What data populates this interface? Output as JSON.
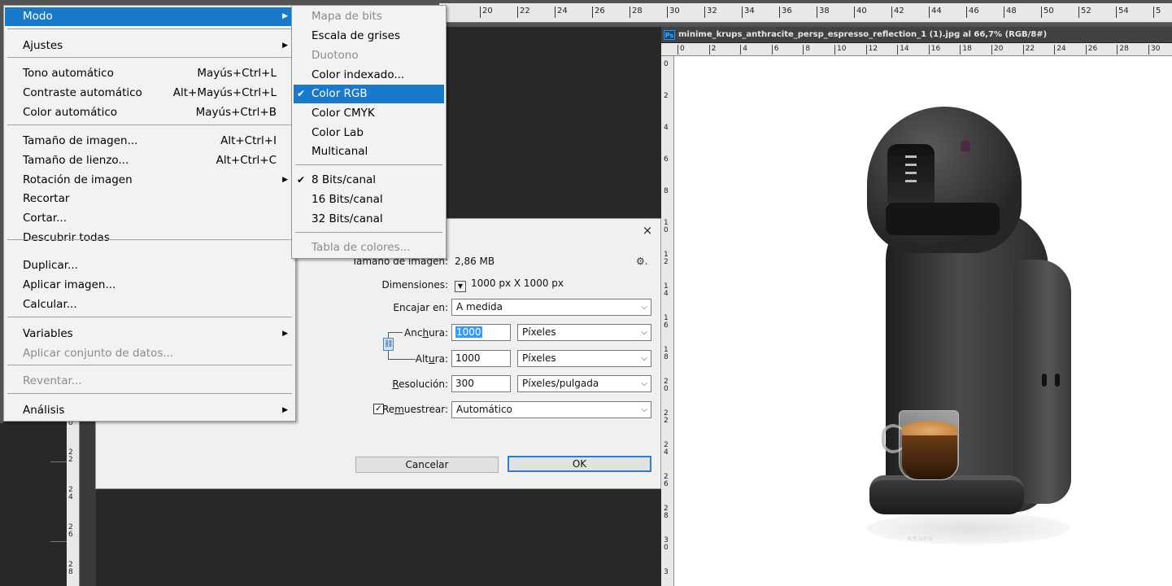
{
  "menu": {
    "items": [
      {
        "label": "Modo",
        "shortcut": "",
        "submenu": true,
        "highlighted": true,
        "disabled": false
      },
      {
        "label": "Ajustes",
        "shortcut": "",
        "submenu": true,
        "highlighted": false,
        "disabled": false
      },
      {
        "label": "Tono automático",
        "shortcut": "Mayús+Ctrl+L"
      },
      {
        "label": "Contraste automático",
        "shortcut": "Alt+Mayús+Ctrl+L"
      },
      {
        "label": "Color automático",
        "shortcut": "Mayús+Ctrl+B"
      },
      {
        "label": "Tamaño de imagen...",
        "shortcut": "Alt+Ctrl+I"
      },
      {
        "label": "Tamaño de lienzo...",
        "shortcut": "Alt+Ctrl+C"
      },
      {
        "label": "Rotación de imagen",
        "shortcut": "",
        "submenu": true
      },
      {
        "label": "Recortar",
        "shortcut": ""
      },
      {
        "label": "Cortar...",
        "shortcut": ""
      },
      {
        "label": "Descubrir todas",
        "shortcut": ""
      },
      {
        "label": "Duplicar...",
        "shortcut": ""
      },
      {
        "label": "Aplicar imagen...",
        "shortcut": ""
      },
      {
        "label": "Calcular...",
        "shortcut": ""
      },
      {
        "label": "Variables",
        "shortcut": "",
        "submenu": true
      },
      {
        "label": "Aplicar conjunto de datos...",
        "shortcut": "",
        "disabled": true
      },
      {
        "label": "Reventar...",
        "shortcut": "",
        "disabled": true
      },
      {
        "label": "Análisis",
        "shortcut": "",
        "submenu": true
      }
    ]
  },
  "submenu": {
    "items": [
      {
        "label": "Mapa de bits",
        "disabled": true,
        "checked": false
      },
      {
        "label": "Escala de grises",
        "disabled": false,
        "checked": false
      },
      {
        "label": "Duotono",
        "disabled": true,
        "checked": false
      },
      {
        "label": "Color indexado...",
        "disabled": false,
        "checked": false
      },
      {
        "label": "Color RGB",
        "disabled": false,
        "checked": true,
        "highlighted": true
      },
      {
        "label": "Color CMYK",
        "disabled": false,
        "checked": false
      },
      {
        "label": "Color Lab",
        "disabled": false,
        "checked": false
      },
      {
        "label": "Multicanal",
        "disabled": false,
        "checked": false
      },
      {
        "label": "8 Bits/canal",
        "disabled": false,
        "checked": true
      },
      {
        "label": "16 Bits/canal",
        "disabled": false,
        "checked": false
      },
      {
        "label": "32 Bits/canal",
        "disabled": false,
        "checked": false
      },
      {
        "label": "Tabla de colores...",
        "disabled": true,
        "checked": false
      }
    ],
    "check_glyph": "✔"
  },
  "document": {
    "badge": "Ps",
    "title": "minime_krups_anthracite_persp_espresso_reflection_1 (1).jpg al 66,7% (RGB/8#)",
    "brand": "KRUPS",
    "ruler_top": [
      "0",
      "2",
      "4",
      "6",
      "8",
      "10",
      "12",
      "14",
      "16",
      "18",
      "20",
      "22",
      "24",
      "26",
      "28",
      "30"
    ],
    "ruler_left": [
      "0",
      "2",
      "4",
      "6",
      "8",
      "1 0",
      "1 2",
      "1 4",
      "1 6",
      "1 8",
      "2 0",
      "2 2",
      "2 4",
      "2 6",
      "2 8",
      "3 0",
      "3"
    ]
  },
  "workspace_ruler": [
    "20",
    "22",
    "24",
    "26",
    "28",
    "30",
    "32",
    "34",
    "36",
    "38",
    "40",
    "42",
    "44",
    "46",
    "48",
    "50",
    "52",
    "54",
    "5"
  ],
  "workspace_left_ruler": [
    "0",
    "2 2",
    "2 4",
    "2 6",
    "2 8"
  ],
  "dialog": {
    "close_glyph": "×",
    "gear_glyph": "⚙.",
    "size_label": "Tamaño de imagen:",
    "size_value": "2,86 MB",
    "dims_label": "Dimensiones:",
    "dims_value": "1000 px X 1000 px",
    "fit_label": "Encajar en:",
    "fit_value": "A medida",
    "width_label_pre": "Anc",
    "width_label_u": "h",
    "width_label_post": "ura:",
    "width_value": "1000",
    "width_unit": "Píxeles",
    "height_label_pre": "Alt",
    "height_label_u": "u",
    "height_label_post": "ra:",
    "height_value": "1000",
    "height_unit": "Píxeles",
    "res_label_u": "R",
    "res_label_post": "esolución:",
    "res_value": "300",
    "res_unit": "Píxeles/pulgada",
    "resample_label_pre": "Re",
    "resample_label_u": "m",
    "resample_label_post": "uestrear:",
    "resample_checked": true,
    "resample_value": "Automático",
    "cancel_label": "Cancelar",
    "ok_label": "OK"
  },
  "colors": {
    "highlight": "#1979ca",
    "menu_bg": "#f2f2f2",
    "workspace": "#282828"
  }
}
